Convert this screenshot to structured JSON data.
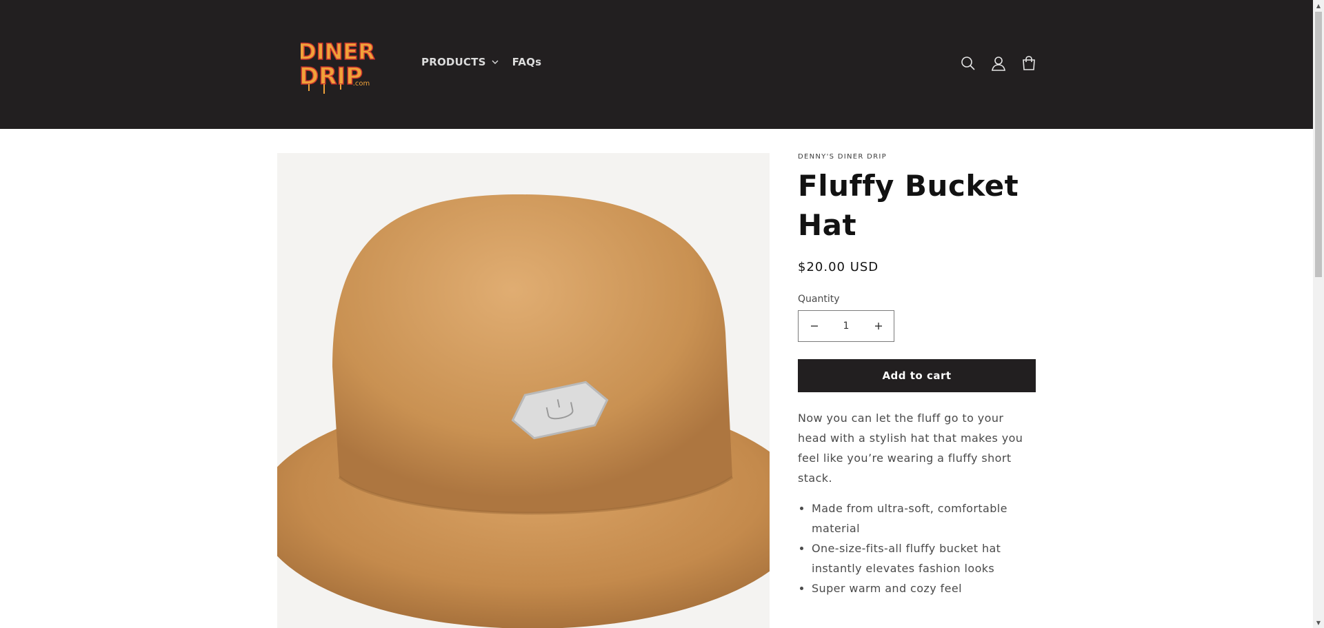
{
  "header": {
    "logo_text": [
      "DINER",
      "DRIP",
      ".com"
    ],
    "nav": [
      {
        "label": "PRODUCTS",
        "has_dropdown": true
      },
      {
        "label": "FAQs",
        "has_dropdown": false
      }
    ],
    "icons": [
      "search-icon",
      "account-icon",
      "cart-icon"
    ],
    "background_color": "#221f20"
  },
  "product": {
    "vendor": "DENNY'S DINER DRIP",
    "title": "Fluffy Bucket Hat",
    "price": "$20.00 USD",
    "quantity_label": "Quantity",
    "quantity_value": "1",
    "add_to_cart_label": "Add to cart",
    "description": "Now you can let the fluff go to your head with a stylish hat that makes you feel like you’re wearing a fluffy short stack.",
    "features": [
      "Made from ultra-soft, comfortable material",
      "One-size-fits-all fluffy bucket hat instantly elevates fashion looks",
      "Super warm and cozy feel"
    ]
  },
  "colors": {
    "accent_dark": "#221f20",
    "logo_orange": "#e9a13a",
    "logo_red": "#c8322c",
    "hat_tan": "#c79156"
  }
}
